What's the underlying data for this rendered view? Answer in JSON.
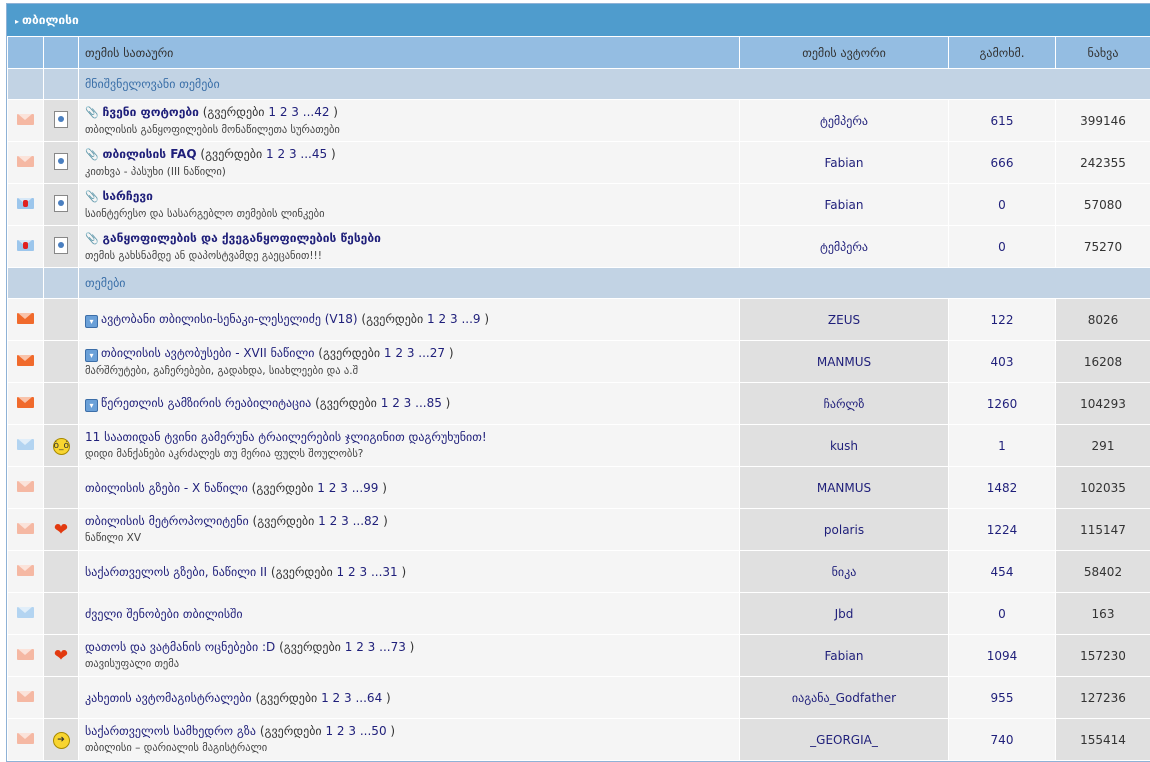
{
  "category": {
    "title": "თბილისი"
  },
  "columns": {
    "title": "თემის სათაური",
    "author": "თემის ავტორი",
    "replies": "გამოხმ.",
    "views": "ნახვა"
  },
  "pages_label": "გვერდები",
  "sections": [
    {
      "label": "მნიშვნელოვანი თემები",
      "topics": [
        {
          "status": "hot",
          "post_icon": "sticky-doc",
          "pinned": true,
          "title": "ჩვენი ფოტოები",
          "pages": [
            "1",
            "2",
            "3",
            "...42"
          ],
          "desc": "თბილისის განყოფილების მონაწილეთა სურათები",
          "author": "ტემპერა",
          "replies": "615",
          "views": "399146"
        },
        {
          "status": "hot",
          "post_icon": "sticky-doc",
          "pinned": true,
          "title": "თბილისის FAQ",
          "pages": [
            "1",
            "2",
            "3",
            "...45"
          ],
          "desc": "კითხვა - პასუხი (III ნაწილი)",
          "author": "Fabian",
          "replies": "666",
          "views": "242355"
        },
        {
          "status": "lock",
          "post_icon": "sticky-doc",
          "pinned": true,
          "title": "სარჩევი",
          "pages": [],
          "desc": "საინტერესო და სასარგებლო თემების ლინკები",
          "author": "Fabian",
          "replies": "0",
          "views": "57080"
        },
        {
          "status": "lock",
          "post_icon": "sticky-doc",
          "pinned": true,
          "title": "განყოფილების და ქვეგანყოფილების წესები",
          "pages": [],
          "desc": "თემის გახსნამდე ან დაპოსტვამდე გაეცანით!!!",
          "author": "ტემპერა",
          "replies": "0",
          "views": "75270"
        }
      ]
    },
    {
      "label": "თემები",
      "topics": [
        {
          "status": "hotnew",
          "post_icon": "",
          "prefix": true,
          "title": "ავტობანი თბილისი-სენაკი-ლესელიძე (V18)",
          "pages": [
            "1",
            "2",
            "3",
            "...9"
          ],
          "desc": "",
          "author": "ZEUS",
          "replies": "122",
          "views": "8026"
        },
        {
          "status": "hotnew",
          "post_icon": "",
          "prefix": true,
          "title": "თბილისის ავტობუსები - XVII ნაწილი",
          "pages": [
            "1",
            "2",
            "3",
            "...27"
          ],
          "desc": "მარშრუტები, გაჩერებები, გადახდა, სიახლეები და ა.შ",
          "author": "MANMUS",
          "replies": "403",
          "views": "16208"
        },
        {
          "status": "hotnew",
          "post_icon": "",
          "prefix": true,
          "title": "წერეთლის გამზირის რეაბილიტაცია",
          "pages": [
            "1",
            "2",
            "3",
            "...85"
          ],
          "desc": "",
          "author": "ჩარლზ",
          "replies": "1260",
          "views": "104293"
        },
        {
          "status": "norm",
          "post_icon": "angry",
          "title": "11 საათიდან ტვინი გამერუნა ტრაილერების ჯლიგინით დაგრუხუნით!",
          "pages": [],
          "desc": "დიდი მანქანები აკრძალეს თუ მერია ფულს შოულობს?",
          "author": "kush",
          "replies": "1",
          "views": "291"
        },
        {
          "status": "hot",
          "post_icon": "",
          "title": "თბილისის გზები - X ნაწილი",
          "pages": [
            "1",
            "2",
            "3",
            "...99"
          ],
          "desc": "",
          "author": "MANMUS",
          "replies": "1482",
          "views": "102035"
        },
        {
          "status": "hot",
          "post_icon": "heart",
          "title": "თბილისის მეტროპოლიტენი",
          "pages": [
            "1",
            "2",
            "3",
            "...82"
          ],
          "desc": "ნაწილი XV",
          "author": "polaris",
          "replies": "1224",
          "views": "115147"
        },
        {
          "status": "hot",
          "post_icon": "",
          "title": "საქართველოს გზები, ნაწილი II",
          "pages": [
            "1",
            "2",
            "3",
            "...31"
          ],
          "desc": "",
          "author": "ნიკა",
          "replies": "454",
          "views": "58402"
        },
        {
          "status": "norm",
          "post_icon": "",
          "title": "ძველი შენობები თბილისში",
          "pages": [],
          "desc": "",
          "author": "Jbd",
          "replies": "0",
          "views": "163"
        },
        {
          "status": "hot",
          "post_icon": "heart",
          "title": "დათოს და ვატმანის ოცნებები :D",
          "pages": [
            "1",
            "2",
            "3",
            "...73"
          ],
          "desc": "თავისუფალი თემა",
          "author": "Fabian",
          "replies": "1094",
          "views": "157230"
        },
        {
          "status": "hot",
          "post_icon": "",
          "title": "კახეთის ავტომაგისტრალები",
          "pages": [
            "1",
            "2",
            "3",
            "...64"
          ],
          "desc": "",
          "author": "იაგანა_Godfather",
          "replies": "955",
          "views": "127236"
        },
        {
          "status": "hot",
          "post_icon": "arrow",
          "title": "საქართველოს სამხედრო გზა",
          "pages": [
            "1",
            "2",
            "3",
            "...50"
          ],
          "desc": "თბილისი – დარიალის მაგისტრალი",
          "author": "_GEORGIA_",
          "replies": "740",
          "views": "155414"
        }
      ]
    }
  ]
}
